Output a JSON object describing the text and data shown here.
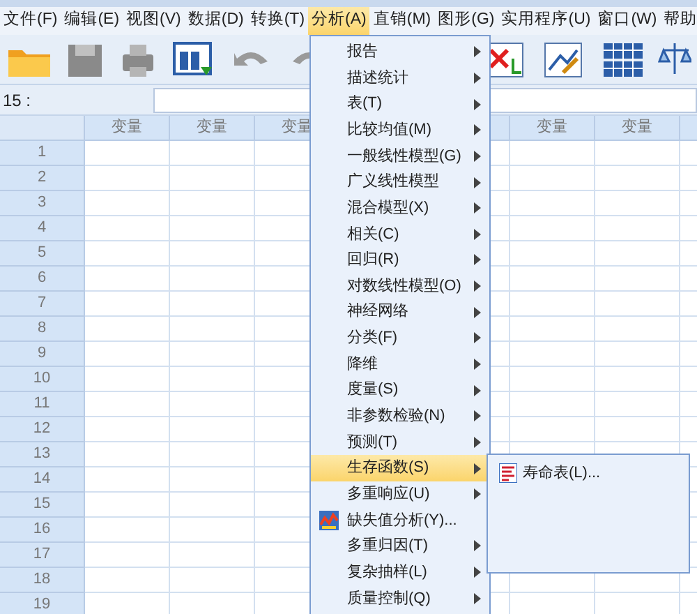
{
  "menu_bar": [
    {
      "label": "文件(F)",
      "selected": false
    },
    {
      "label": "编辑(E)",
      "selected": false
    },
    {
      "label": "视图(V)",
      "selected": false
    },
    {
      "label": "数据(D)",
      "selected": false
    },
    {
      "label": "转换(T)",
      "selected": false
    },
    {
      "label": "分析(A)",
      "selected": true
    },
    {
      "label": "直销(M)",
      "selected": false
    },
    {
      "label": "图形(G)",
      "selected": false
    },
    {
      "label": "实用程序(U)",
      "selected": false
    },
    {
      "label": "窗口(W)",
      "selected": false
    },
    {
      "label": "帮助",
      "selected": false
    }
  ],
  "cell_reference": "15 :",
  "columns": [
    {
      "kind": "label",
      "label": "变量"
    },
    {
      "kind": "label",
      "label": "变量"
    },
    {
      "kind": "label",
      "label": "变量"
    },
    {
      "kind": "hidden"
    },
    {
      "kind": "covered"
    },
    {
      "kind": "label",
      "label": "变量"
    },
    {
      "kind": "label",
      "label": "变量"
    },
    {
      "kind": "blank"
    }
  ],
  "rows": [
    "1",
    "2",
    "3",
    "4",
    "5",
    "6",
    "7",
    "8",
    "9",
    "10",
    "11",
    "12",
    "13",
    "14",
    "15",
    "16",
    "17",
    "18",
    "19"
  ],
  "analyze_menu": [
    {
      "label": "报告",
      "kind": "submenu",
      "selected": false
    },
    {
      "label": "描述统计",
      "kind": "submenu",
      "selected": false
    },
    {
      "label": "表(T)",
      "kind": "submenu",
      "selected": false
    },
    {
      "label": "比较均值(M)",
      "kind": "submenu",
      "selected": false
    },
    {
      "label": "一般线性模型(G)",
      "kind": "submenu",
      "selected": false
    },
    {
      "label": "广义线性模型",
      "kind": "submenu",
      "selected": false
    },
    {
      "label": "混合模型(X)",
      "kind": "submenu",
      "selected": false
    },
    {
      "label": "相关(C)",
      "kind": "submenu",
      "selected": false
    },
    {
      "label": "回归(R)",
      "kind": "submenu",
      "selected": false
    },
    {
      "label": "对数线性模型(O)",
      "kind": "submenu",
      "selected": false
    },
    {
      "label": "神经网络",
      "kind": "submenu",
      "selected": false
    },
    {
      "label": "分类(F)",
      "kind": "submenu",
      "selected": false
    },
    {
      "label": "降维",
      "kind": "submenu",
      "selected": false
    },
    {
      "label": "度量(S)",
      "kind": "submenu",
      "selected": false
    },
    {
      "label": "非参数检验(N)",
      "kind": "submenu",
      "selected": false
    },
    {
      "label": "预测(T)",
      "kind": "submenu",
      "selected": false
    },
    {
      "label": "生存函数(S)",
      "kind": "submenu",
      "selected": true
    },
    {
      "label": "多重响应(U)",
      "kind": "submenu",
      "selected": false
    },
    {
      "label": "缺失值分析(Y)...",
      "kind": "action",
      "selected": false
    },
    {
      "label": "多重归因(T)",
      "kind": "submenu",
      "selected": false
    },
    {
      "label": "复杂抽样(L)",
      "kind": "submenu",
      "selected": false
    },
    {
      "label": "质量控制(Q)",
      "kind": "submenu",
      "selected": false
    }
  ],
  "survival_submenu": [
    {
      "label": "寿命表(L)..."
    }
  ]
}
